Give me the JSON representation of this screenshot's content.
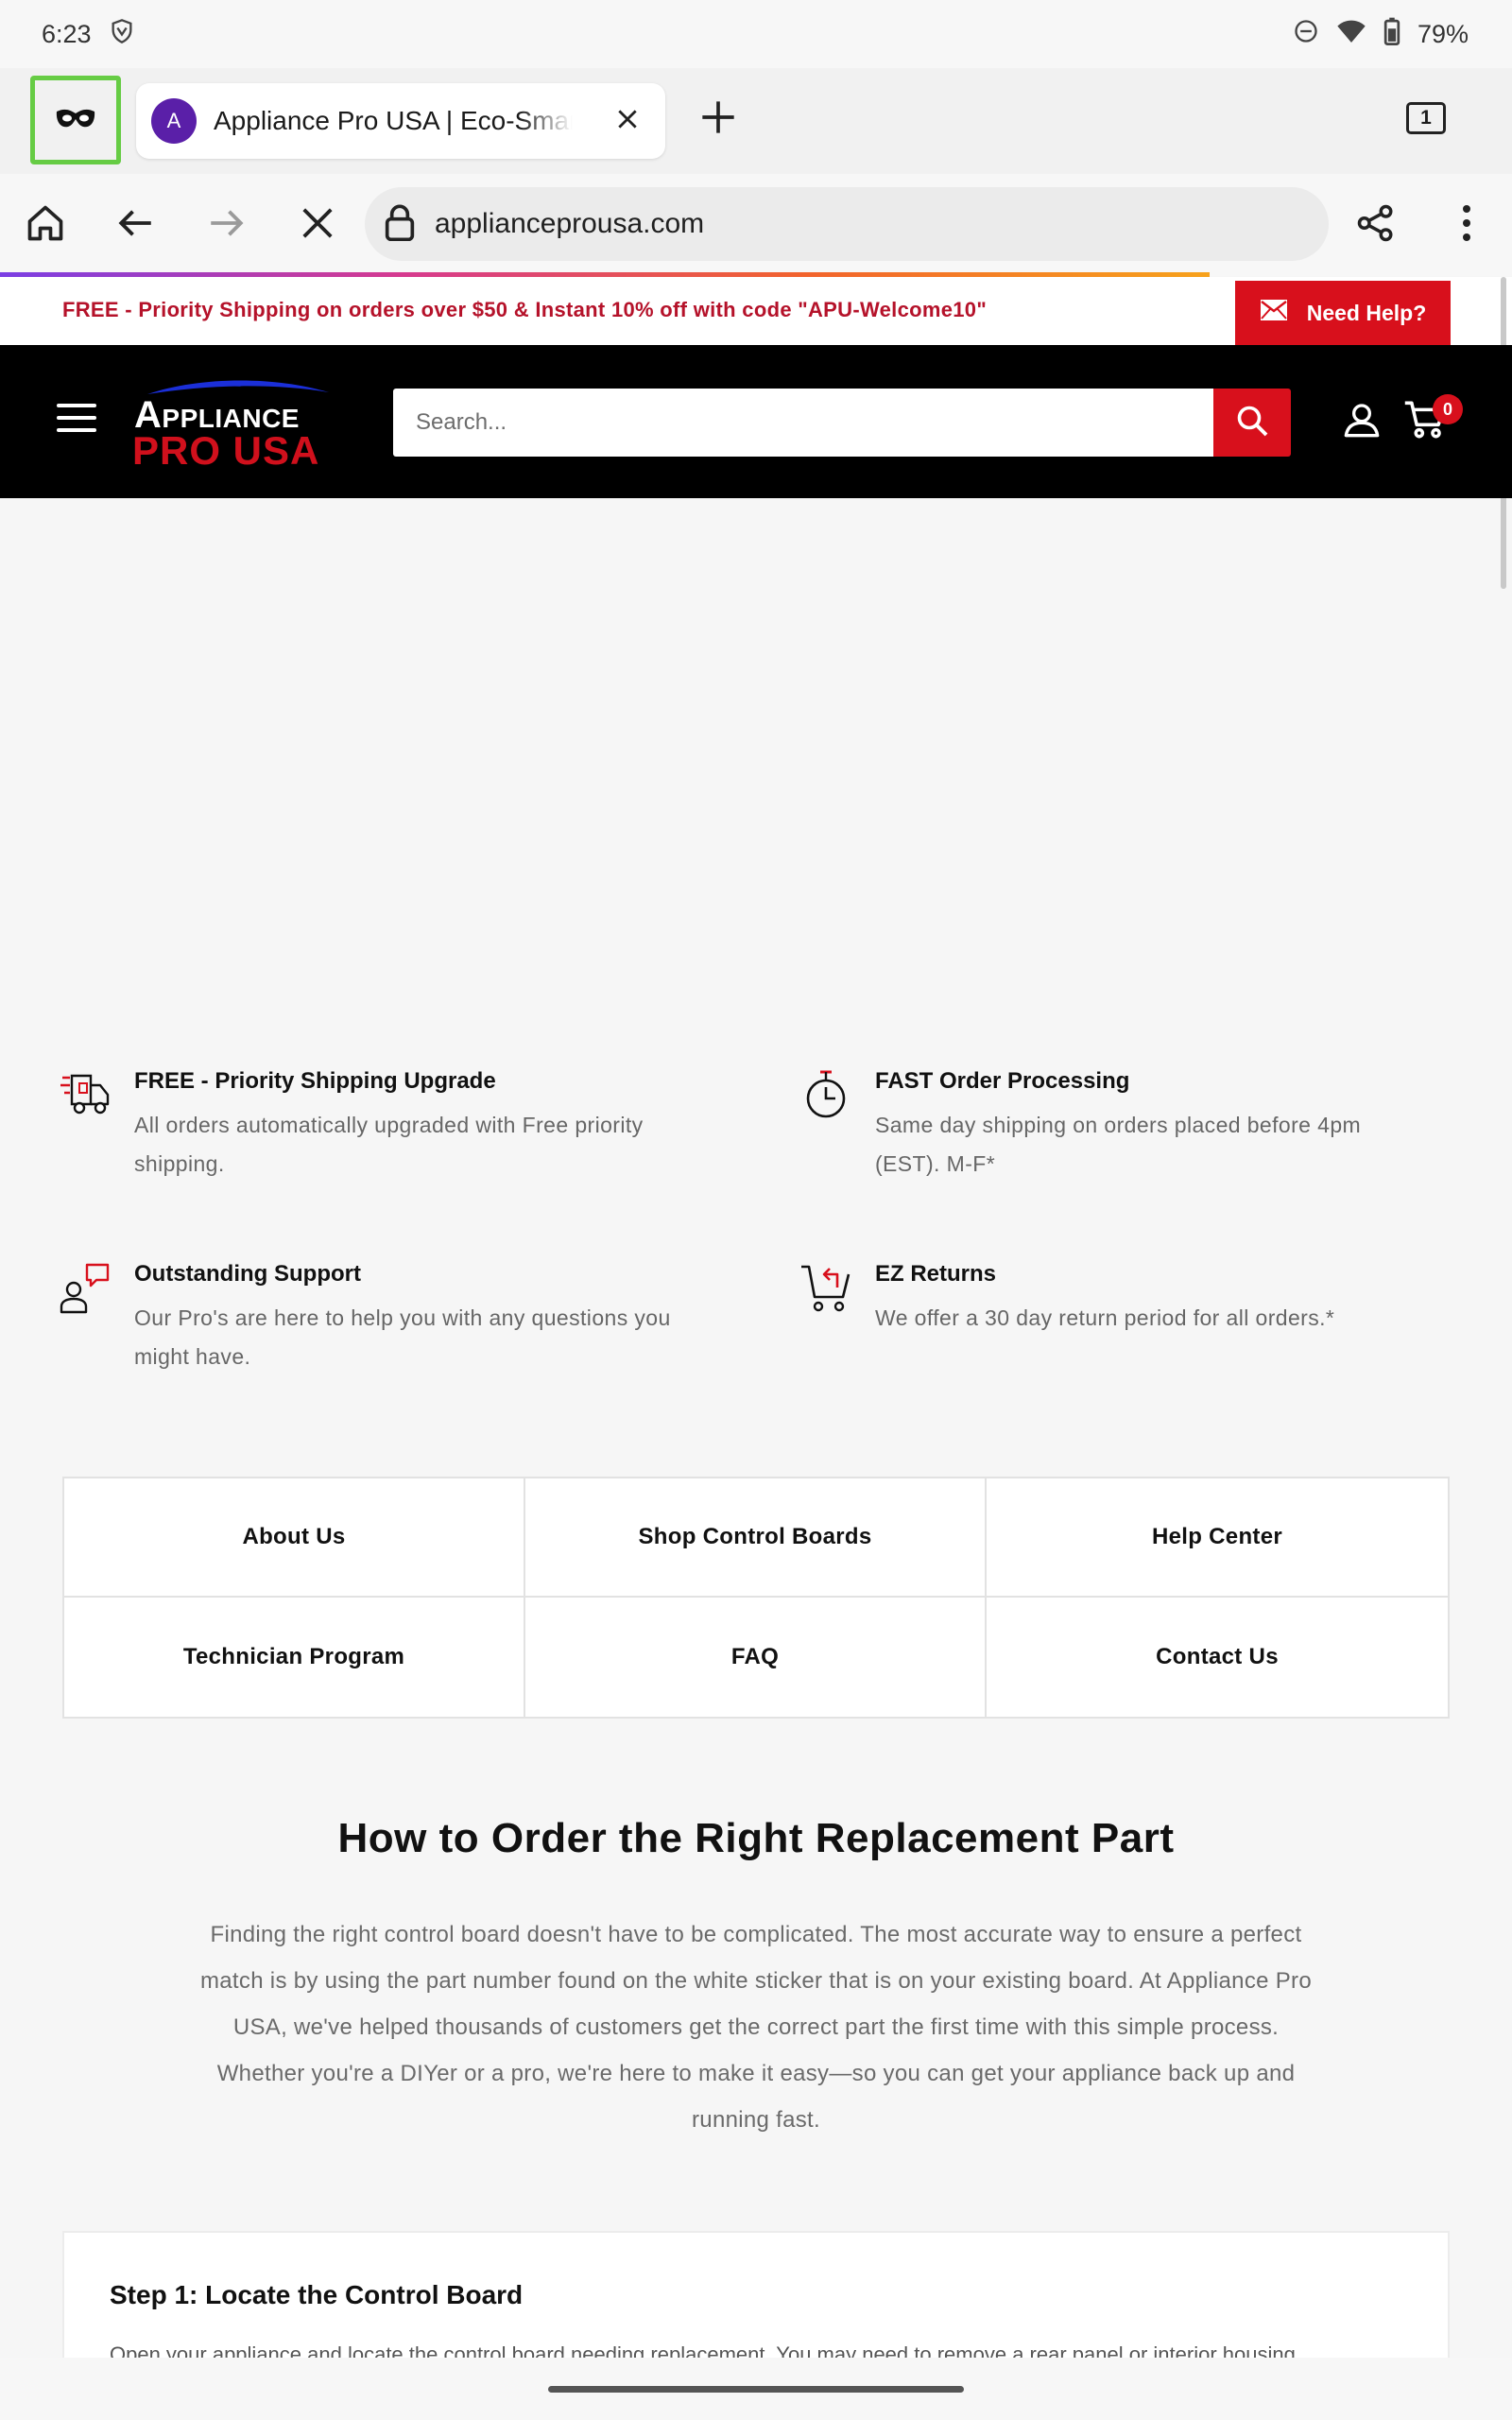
{
  "status_bar": {
    "time": "6:23",
    "battery": "79%"
  },
  "browser": {
    "tab_title": "Appliance Pro USA | Eco-Smart",
    "tab_favicon_letter": "A",
    "tab_count": "1",
    "url": "applianceprousa.com",
    "accent_progress": "#f7a21b"
  },
  "announcement": {
    "text": "FREE - Priority Shipping on orders over $50 & Instant 10% off with code \"APU-Welcome10\"",
    "help_label": "Need Help?"
  },
  "header": {
    "logo_top": "Appliance",
    "logo_bottom": "PRO USA",
    "search_placeholder": "Search...",
    "cart_count": "0",
    "brand_red": "#d8101c"
  },
  "features": [
    {
      "icon": "shipping-truck-icon",
      "title": "FREE - Priority Shipping Upgrade",
      "desc": "All orders automatically upgraded with Free priority shipping."
    },
    {
      "icon": "stopwatch-icon",
      "title": "FAST Order Processing",
      "desc": "Same day shipping on orders placed before 4pm (EST). M-F*"
    },
    {
      "icon": "support-person-icon",
      "title": "Outstanding Support",
      "desc": "Our Pro's are here to help you with any questions you might have."
    },
    {
      "icon": "cart-return-icon",
      "title": "EZ Returns",
      "desc": "We offer a 30 day return period for all orders.*"
    }
  ],
  "links": [
    "About Us",
    "Shop Control Boards",
    "Help Center",
    "Technician Program",
    "FAQ",
    "Contact Us"
  ],
  "howto": {
    "title": "How to Order the Right Replacement Part",
    "body": "Finding the right control board doesn't have to be complicated. The most accurate way to ensure a perfect match is by using the part number found on the white sticker that is on your existing board. At Appliance Pro USA, we've helped thousands of customers get the correct part the first time with this simple process. Whether you're a DIYer or a pro, we're here to make it easy—so you can get your appliance back up and running fast."
  },
  "step1": {
    "title": "Step 1: Locate the Control Board",
    "text": "Open your appliance and locate the control board needing replacement. You may need to remove a rear panel or interior housing"
  }
}
